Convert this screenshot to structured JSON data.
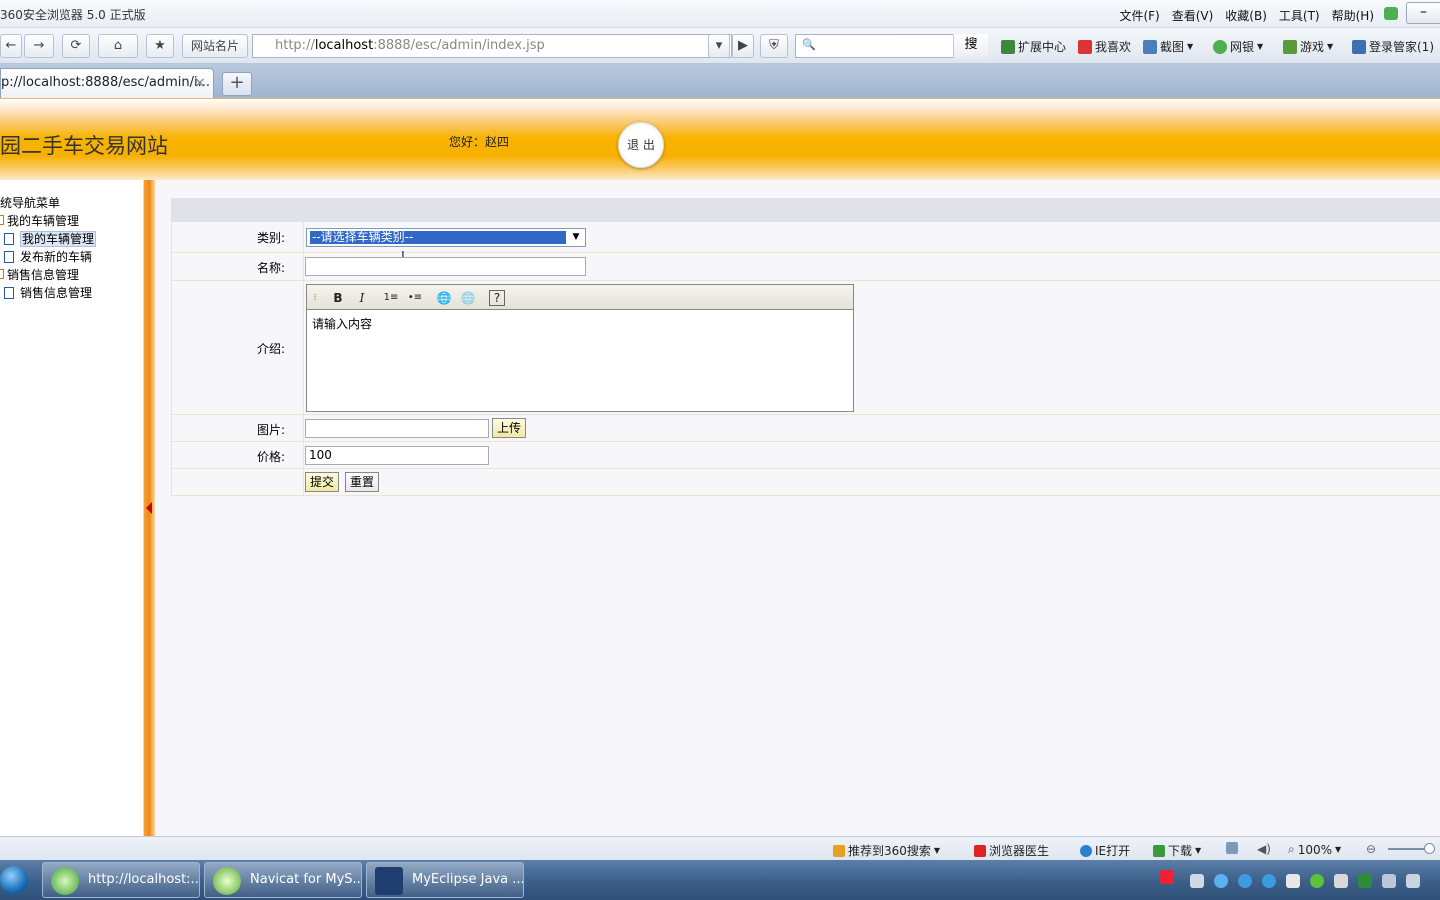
{
  "browser": {
    "title": "360安全浏览器 5.0 正式版",
    "menus": [
      "文件(F)",
      "查看(V)",
      "收藏(B)",
      "工具(T)",
      "帮助(H)"
    ],
    "min_label": "–",
    "nav": {
      "site_cards": "网站名片",
      "search_btn": "搜",
      "addr_prefix": "http://",
      "addr_host": "localhost",
      "addr_path": ":8888/esc/admin/index.jsp",
      "search_glyph": "🔍",
      "dropdown_glyph": "⌄"
    },
    "toolbar_links": [
      "扩展中心",
      "我喜欢",
      "截图",
      "网银",
      "游戏",
      "登录管家(1)"
    ],
    "tab": {
      "label": "p://localhost:8888/esc/admin/i...",
      "close": "×",
      "new": "+"
    }
  },
  "site": {
    "title": "园二手车交易网站",
    "greeting": "您好：赵四",
    "logout": "退 出"
  },
  "sidebar": {
    "root": "统导航菜单",
    "groups": [
      {
        "label": "我的车辆管理",
        "items": [
          "我的车辆管理",
          "发布新的车辆"
        ]
      },
      {
        "label": "销售信息管理",
        "items": [
          "销售信息管理"
        ]
      }
    ]
  },
  "form": {
    "category_label": "类别:",
    "category_value": "--请选择车辆类别--",
    "name_label": "名称:",
    "name_value": "",
    "intro_label": "介绍:",
    "intro_value": "请输入内容",
    "image_label": "图片:",
    "image_value": "",
    "upload_button": "上传",
    "price_label": "价格:",
    "price_value": "100",
    "submit_button": "提交",
    "reset_button": "重置",
    "editor_tools": [
      "B",
      "I",
      "1≡",
      "•≡",
      "🌐",
      "🌐",
      "?"
    ]
  },
  "statusbar": {
    "items": [
      "推荐到360搜索",
      "浏览器医生",
      "IE打开",
      "下载"
    ],
    "zoom": "100%"
  },
  "taskbar": {
    "tasks": [
      "http://localhost:...",
      "Navicat for MyS...",
      "MyEclipse Java ..."
    ]
  },
  "colors": {
    "banner": "#f8b400",
    "splitter": "#f08a10",
    "selection": "#3167c5"
  }
}
